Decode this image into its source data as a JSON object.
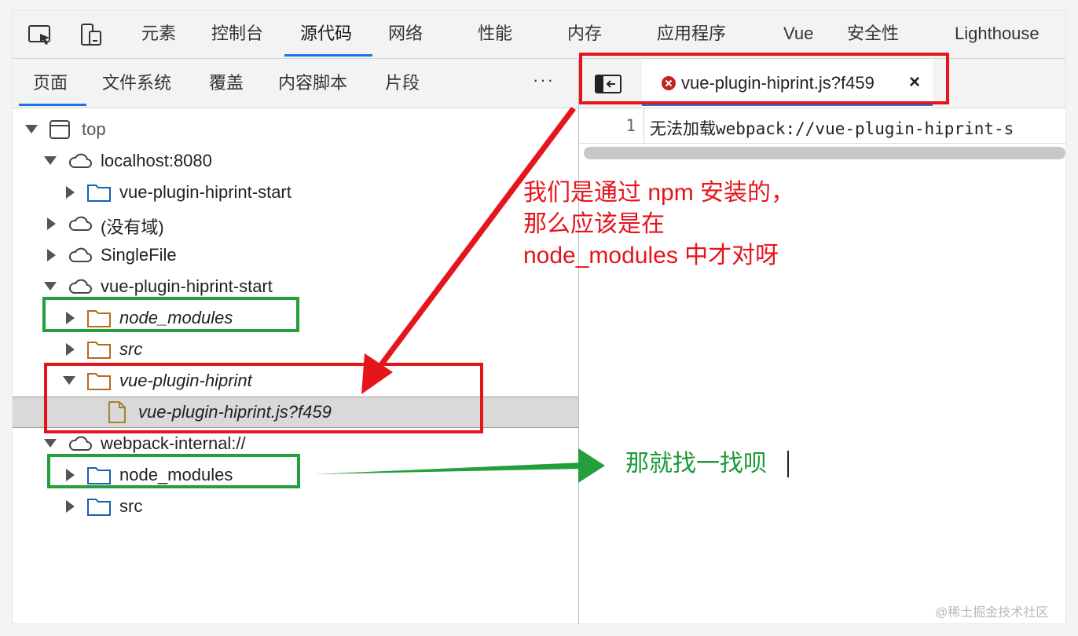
{
  "topbar": {
    "tabs": [
      "元素",
      "控制台",
      "源代码",
      "网络",
      "性能",
      "内存",
      "应用程序",
      "Vue",
      "安全性",
      "Lighthouse"
    ],
    "active_index": 2
  },
  "navigator": {
    "tabs": [
      "页面",
      "文件系统",
      "覆盖",
      "内容脚本",
      "片段"
    ],
    "more": "···",
    "tree": [
      "top",
      "localhost:8080",
      "vue-plugin-hiprint-start",
      "(没有域)",
      "SingleFile",
      "vue-plugin-hiprint-start",
      "node_modules",
      "src",
      "vue-plugin-hiprint",
      "vue-plugin-hiprint.js?f459",
      "webpack-internal://",
      "node_modules",
      "src"
    ]
  },
  "editor": {
    "file_tab": "vue-plugin-hiprint.js?f459",
    "close": "×",
    "line_number": "1",
    "line_text": "无法加载webpack://vue-plugin-hiprint-s"
  },
  "annotations": {
    "red_note": [
      "我们是通过 npm 安装的，",
      "那么应该是在",
      "node_modules 中才对呀"
    ],
    "green_note": "那就找一找呗"
  },
  "watermark": "@稀土掘金技术社区",
  "colors": {
    "red": "#e5151b",
    "green": "#23a03b",
    "accent": "#1a73e8",
    "folder_blue": "#1a5fb4",
    "folder_orange": "#b36b1e"
  }
}
